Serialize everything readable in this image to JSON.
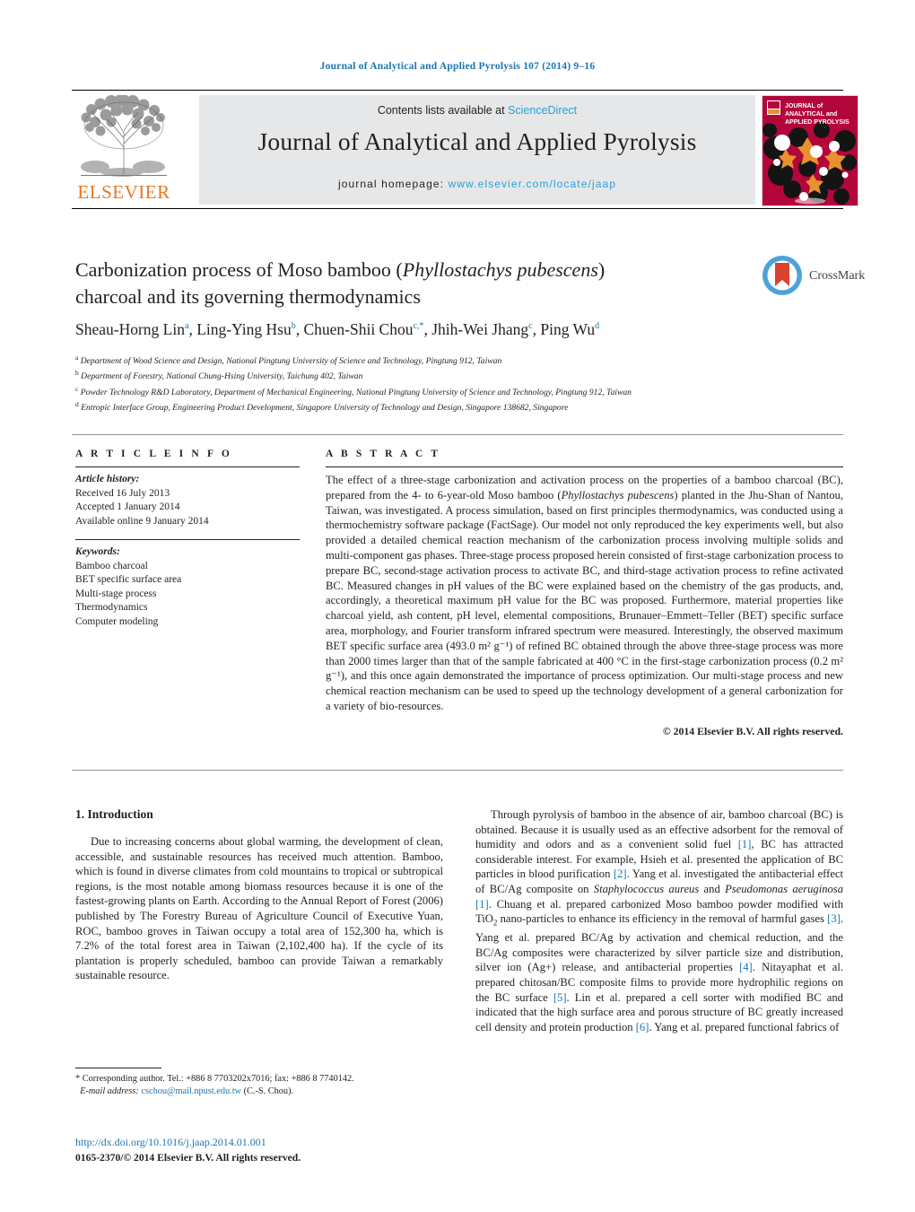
{
  "header": {
    "citation": "Journal of Analytical and Applied Pyrolysis 107 (2014) 9–16",
    "contents_prefix": "Contents lists available at ",
    "contents_link": "ScienceDirect",
    "journal_title": "Journal of Analytical and Applied Pyrolysis",
    "homepage_label": "journal homepage:",
    "homepage_url": "www.elsevier.com/locate/jaap",
    "publisher_logo_text": "ELSEVIER",
    "cover_title_line1": "JOURNAL of",
    "cover_title_line2": "ANALYTICAL and",
    "cover_title_line3": "APPLIED PYROLYSIS",
    "accent_blue": "#1b75b0",
    "link_blue": "#2a9fd6",
    "elsevier_orange": "#e87722",
    "masthead_gray": "#e6e7e8",
    "cover_crimson": "#b3063b"
  },
  "title": {
    "line1_pre": "Carbonization process of Moso bamboo (",
    "line1_italic": "Phyllostachys pubescens",
    "line1_post": ")",
    "line2": "charcoal and its governing thermodynamics"
  },
  "crossmark": {
    "label": "CrossMark"
  },
  "authors": {
    "list": "Sheau-Horng Lin a, Ling-Ying Hsu b, Chuen-Shii Chou c,*, Jhih-Wei Jhang c, Ping Wu d",
    "a1": "Sheau-Horng Lin",
    "s1": "a",
    "a2": "Ling-Ying Hsu",
    "s2": "b",
    "a3": "Chuen-Shii Chou",
    "s3": "c,*",
    "a4": "Jhih-Wei Jhang",
    "s4": "c",
    "a5": "Ping Wu",
    "s5": "d"
  },
  "affiliations": [
    {
      "marker": "a",
      "text": "Department of Wood Science and Design, National Pingtung University of Science and Technology, Pingtung 912, Taiwan"
    },
    {
      "marker": "b",
      "text": "Department of Forestry, National Chung-Hsing University, Taichung 402, Taiwan"
    },
    {
      "marker": "c",
      "text": "Powder Technology R&D Laboratory, Department of Mechanical Engineering, National Pingtung University of Science and Technology, Pingtung 912, Taiwan"
    },
    {
      "marker": "d",
      "text": "Entropic Interface Group, Engineering Product Development, Singapore University of Technology and Design, Singapore 138682, Singapore"
    }
  ],
  "article_info": {
    "heading": "A R T I C L E  I N F O",
    "history_label": "Article history:",
    "history": [
      "Received 16 July 2013",
      "Accepted 1 January 2014",
      "Available online 9 January 2014"
    ],
    "keywords_label": "Keywords:",
    "keywords": [
      "Bamboo charcoal",
      "BET specific surface area",
      "Multi-stage process",
      "Thermodynamics",
      "Computer modeling"
    ]
  },
  "abstract": {
    "heading": "A B S T R A C T",
    "p1": "The effect of a three-stage carbonization and activation process on the properties of a bamboo charcoal (BC), prepared from the 4- to 6-year-old Moso bamboo (",
    "species": "Phyllostachys pubescens",
    "p2": ") planted in the Jhu-Shan of Nantou, Taiwan, was investigated. A process simulation, based on first principles thermodynamics, was conducted using a thermochemistry software package (FactSage). Our model not only reproduced the key experiments well, but also provided a detailed chemical reaction mechanism of the carbonization process involving multiple solids and multi-component gas phases. Three-stage process proposed herein consisted of first-stage carbonization process to prepare BC, second-stage activation process to activate BC, and third-stage activation process to refine activated BC. Measured changes in pH values of the BC were explained based on the chemistry of the gas products, and, accordingly, a theoretical maximum pH value for the BC was proposed. Furthermore, material properties like charcoal yield, ash content, pH level, elemental compositions, Brunauer–Emmett–Teller (BET) specific surface area, morphology, and Fourier transform infrared spectrum were measured. Interestingly, the observed maximum BET specific surface area (493.0 m² g⁻¹) of refined BC obtained through the above three-stage process was more than 2000 times larger than that of the sample fabricated at 400 °C in the first-stage carbonization process (0.2 m² g⁻¹), and this once again demonstrated the importance of process optimization. Our multi-stage process and new chemical reaction mechanism can be used to speed up the technology development of a general carbonization for a variety of bio-resources.",
    "copyright": "© 2014 Elsevier B.V. All rights reserved."
  },
  "body": {
    "section1_heading": "1. Introduction",
    "left_para1_a": "Due to increasing concerns about global warming, the development of clean, accessible, and sustainable resources has received much attention. Bamboo, which is found in diverse climates from cold mountains to tropical or subtropical regions, is the most notable among biomass resources because it is one of the fastest-growing plants on Earth. According to the Annual Report of Forest (2006) published by The Forestry Bureau of Agriculture Council of Executive Yuan, ROC, bamboo groves in Taiwan occupy a total area of 152,300 ha, which is 7.2% of the total forest area in Taiwan (2,102,400 ha). If the cycle of its plantation is properly scheduled, bamboo can provide Taiwan a remarkably sustainable resource.",
    "right_t1": "Through pyrolysis of bamboo in the absence of air, bamboo charcoal (BC) is obtained. Because it is usually used as an effective adsorbent for the removal of humidity and odors and as a convenient solid fuel ",
    "right_r1": "[1]",
    "right_t2": ", BC has attracted considerable interest. For example, Hsieh et al. presented the application of BC particles in blood purification ",
    "right_r2": "[2]",
    "right_t3": ". Yang et al. investigated the antibacterial effect of BC/Ag composite on ",
    "right_i1": "Staphylococcus aureus",
    "right_t4": " and ",
    "right_i2": "Pseudomonas aeruginosa",
    "right_t5": " ",
    "right_r3": "[1]",
    "right_t6": ". Chuang et al. prepared carbonized Moso bamboo powder modified with TiO",
    "right_sub1": "2",
    "right_t7": " nano-particles to enhance its efficiency in the removal of harmful gases ",
    "right_r4": "[3]",
    "right_t8": ". Yang et al. prepared BC/Ag by activation and chemical reduction, and the BC/Ag composites were characterized by silver particle size and distribution, silver ion (Ag+) release, and antibacterial properties ",
    "right_r5": "[4]",
    "right_t9": ". Nitayaphat et al. prepared chitosan/BC composite films to provide more hydrophilic regions on the BC surface ",
    "right_r6": "[5]",
    "right_t10": ". Lin et al. prepared a cell sorter with modified BC and indicated that the high surface area and porous structure of BC greatly increased cell density and protein production ",
    "right_r7": "[6]",
    "right_t11": ". Yang et al. prepared functional fabrics of"
  },
  "footnote": {
    "star": "*",
    "corresponding": "Corresponding author. Tel.: +886 8 7703202x7016; fax: +886 8 7740142.",
    "email_label": "E-mail address:",
    "email": "cschou@mail.npust.edu.tw",
    "email_suffix": "(C.-S. Chou)."
  },
  "footer": {
    "doi": "http://dx.doi.org/10.1016/j.jaap.2014.01.001",
    "issn": "0165-2370/© 2014 Elsevier B.V. All rights reserved."
  }
}
